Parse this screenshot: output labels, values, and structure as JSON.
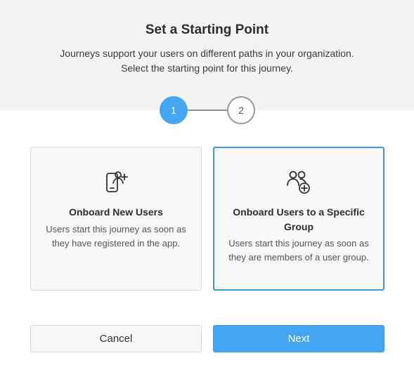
{
  "header": {
    "title": "Set a Starting Point",
    "subtitle_line1": "Journeys support your users on different paths in your organization.",
    "subtitle_line2": "Select the starting point for this journey."
  },
  "stepper": {
    "steps": [
      {
        "label": "1",
        "state": "active"
      },
      {
        "label": "2",
        "state": "inactive"
      }
    ],
    "active_color": "#45a6f2"
  },
  "cards": [
    {
      "icon": "phone-add-user-icon",
      "title": "Onboard New Users",
      "description": "Users start this journey as soon as they have registered in the app.",
      "selected": false
    },
    {
      "icon": "group-add-icon",
      "title": "Onboard Users to a Specific Group",
      "description": "Users start this journey as soon as they are members of a user group.",
      "selected": true
    }
  ],
  "buttons": {
    "cancel_label": "Cancel",
    "next_label": "Next"
  },
  "colors": {
    "accent": "#44a6f3",
    "selected_border": "#3a99da",
    "header_bg": "#f3f3f3"
  }
}
